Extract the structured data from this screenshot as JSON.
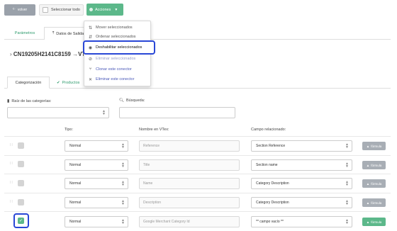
{
  "toolbar": {
    "back_label": "volver",
    "select_all_label": "Seleccionar todo",
    "actions_label": "Acciones"
  },
  "actions_menu": {
    "items": [
      {
        "icon": "move-icon",
        "label": "Mover seleccionados"
      },
      {
        "icon": "sort-icon",
        "label": "Ordenar seleccionados"
      },
      {
        "icon": "eye-slash-icon",
        "label": "Deshabilitar seleccionados"
      },
      {
        "icon": "trash-icon",
        "label": "Eliminar seleccionados"
      },
      {
        "icon": "fork-icon",
        "label": "Clonar este conector"
      },
      {
        "icon": "close-icon",
        "label": "Eliminar este conector"
      }
    ]
  },
  "tabs": {
    "params": "Parámetros",
    "output": "Datos de Salida"
  },
  "sku": {
    "code": "CN19205H2141C8159",
    "arrow": "→",
    "target": "VTe"
  },
  "subtabs": {
    "categorization": "Categorización",
    "products": "Productos"
  },
  "filters": {
    "root_label": "Raíz de las categorías:",
    "search_label": "Búsqueda:"
  },
  "table": {
    "headers": {
      "type": "Tipo:",
      "vtex_name": "Nombre en VTex:",
      "related": "Campo relacionado:"
    },
    "formula_label": "fórmula",
    "rows": [
      {
        "type": "Normal",
        "name": "Reference",
        "field": "Section Reference",
        "checked": false
      },
      {
        "type": "Normal",
        "name": "Title",
        "field": "Section name",
        "checked": false
      },
      {
        "type": "Normal",
        "name": "Name",
        "field": "Category Description",
        "checked": false
      },
      {
        "type": "Normal",
        "name": "Description",
        "field": "Category Description",
        "checked": false
      },
      {
        "type": "Normal",
        "name": "Google Merchant Category Id",
        "field": "** campo vacío **",
        "checked": true
      }
    ]
  },
  "colors": {
    "accent": "#5cb88a",
    "highlight": "#2947d6",
    "grey_button": "#9aa1aa"
  }
}
